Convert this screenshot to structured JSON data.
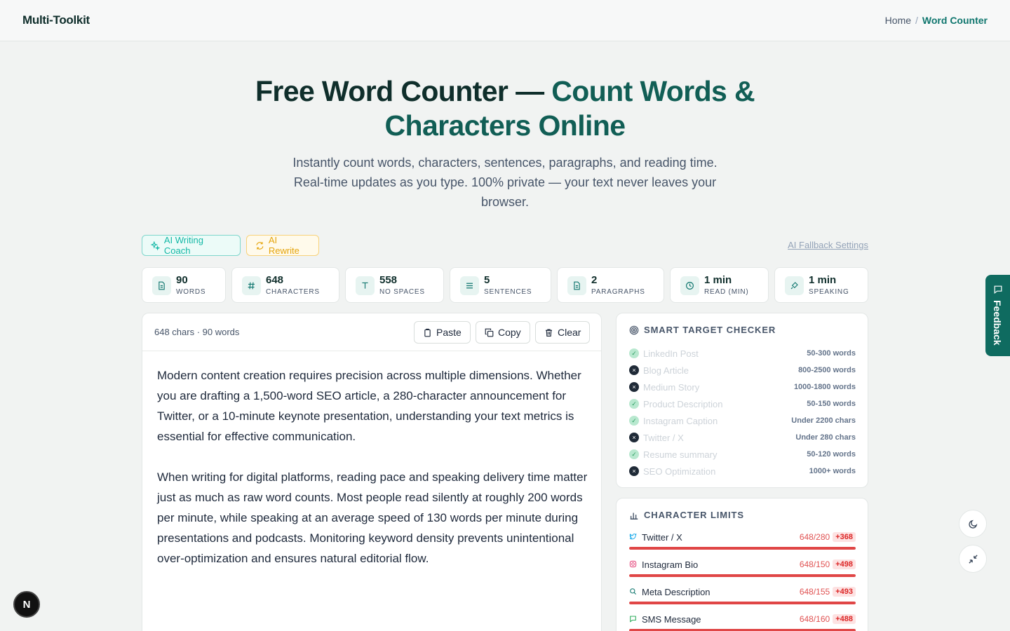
{
  "header": {
    "brand": "Multi-Toolkit",
    "breadcrumb": {
      "home": "Home",
      "separator": "/",
      "current": "Word Counter"
    }
  },
  "hero": {
    "title_part1": "Free Word Counter — ",
    "title_part2": "Count Words &",
    "title_line2": "Characters Online",
    "subtitle": "Instantly count words, characters, sentences, paragraphs, and reading time. Real-time updates as you type. 100% private — your text never leaves your browser."
  },
  "ai": {
    "coach_label": "AI Writing Coach",
    "rewrite_label": "AI Rewrite",
    "fallback_label": "AI Fallback Settings"
  },
  "stats": [
    {
      "value": "90",
      "label": "WORDS",
      "icon": "document-icon"
    },
    {
      "value": "648",
      "label": "CHARACTERS",
      "icon": "hash-icon"
    },
    {
      "value": "558",
      "label": "NO SPACES",
      "icon": "text-icon"
    },
    {
      "value": "5",
      "label": "SENTENCES",
      "icon": "lines-icon"
    },
    {
      "value": "2",
      "label": "PARAGRAPHS",
      "icon": "document-icon"
    },
    {
      "value": "1 min",
      "label": "READ (MIN)",
      "icon": "clock-icon"
    },
    {
      "value": "1 min",
      "label": "SPEAKING",
      "icon": "mic-icon"
    }
  ],
  "editor": {
    "meta": "648 chars · 90 words",
    "paste": "Paste",
    "copy": "Copy",
    "clear": "Clear",
    "paragraphs": [
      "Modern content creation requires precision across multiple dimensions. Whether you are drafting a 1,500-word SEO article, a 280-character announcement for Twitter, or a 10-minute keynote presentation, understanding your text metrics is essential for effective communication.",
      "When writing for digital platforms, reading pace and speaking delivery time matter just as much as raw word counts. Most people read silently at roughly 200 words per minute, while speaking at an average speed of 130 words per minute during presentations and podcasts. Monitoring keyword density prevents unintentional over-optimization and ensures natural editorial flow."
    ]
  },
  "targets": {
    "title": "SMART TARGET CHECKER",
    "items": [
      {
        "name": "LinkedIn Post",
        "req": "50-300 words",
        "status": "ok"
      },
      {
        "name": "Blog Article",
        "req": "800-2500 words",
        "status": "no"
      },
      {
        "name": "Medium Story",
        "req": "1000-1800 words",
        "status": "no"
      },
      {
        "name": "Product Description",
        "req": "50-150 words",
        "status": "ok"
      },
      {
        "name": "Instagram Caption",
        "req": "Under 2200 chars",
        "status": "ok"
      },
      {
        "name": "Twitter / X",
        "req": "Under 280 chars",
        "status": "no"
      },
      {
        "name": "Resume summary",
        "req": "50-120 words",
        "status": "ok"
      },
      {
        "name": "SEO Optimization",
        "req": "1000+ words",
        "status": "no"
      }
    ]
  },
  "limits": {
    "title": "CHARACTER LIMITS",
    "items": [
      {
        "name": "Twitter / X",
        "count": "648/280",
        "over": "+368",
        "icon": "twitter-icon",
        "fill": 1.0
      },
      {
        "name": "Instagram Bio",
        "count": "648/150",
        "over": "+498",
        "icon": "instagram-icon",
        "fill": 1.0
      },
      {
        "name": "Meta Description",
        "count": "648/155",
        "over": "+493",
        "icon": "search-icon",
        "fill": 1.0
      },
      {
        "name": "SMS Message",
        "count": "648/160",
        "over": "+488",
        "icon": "message-icon",
        "fill": 1.0
      }
    ]
  },
  "floating": {
    "feedback": "Feedback",
    "badge": "N"
  }
}
